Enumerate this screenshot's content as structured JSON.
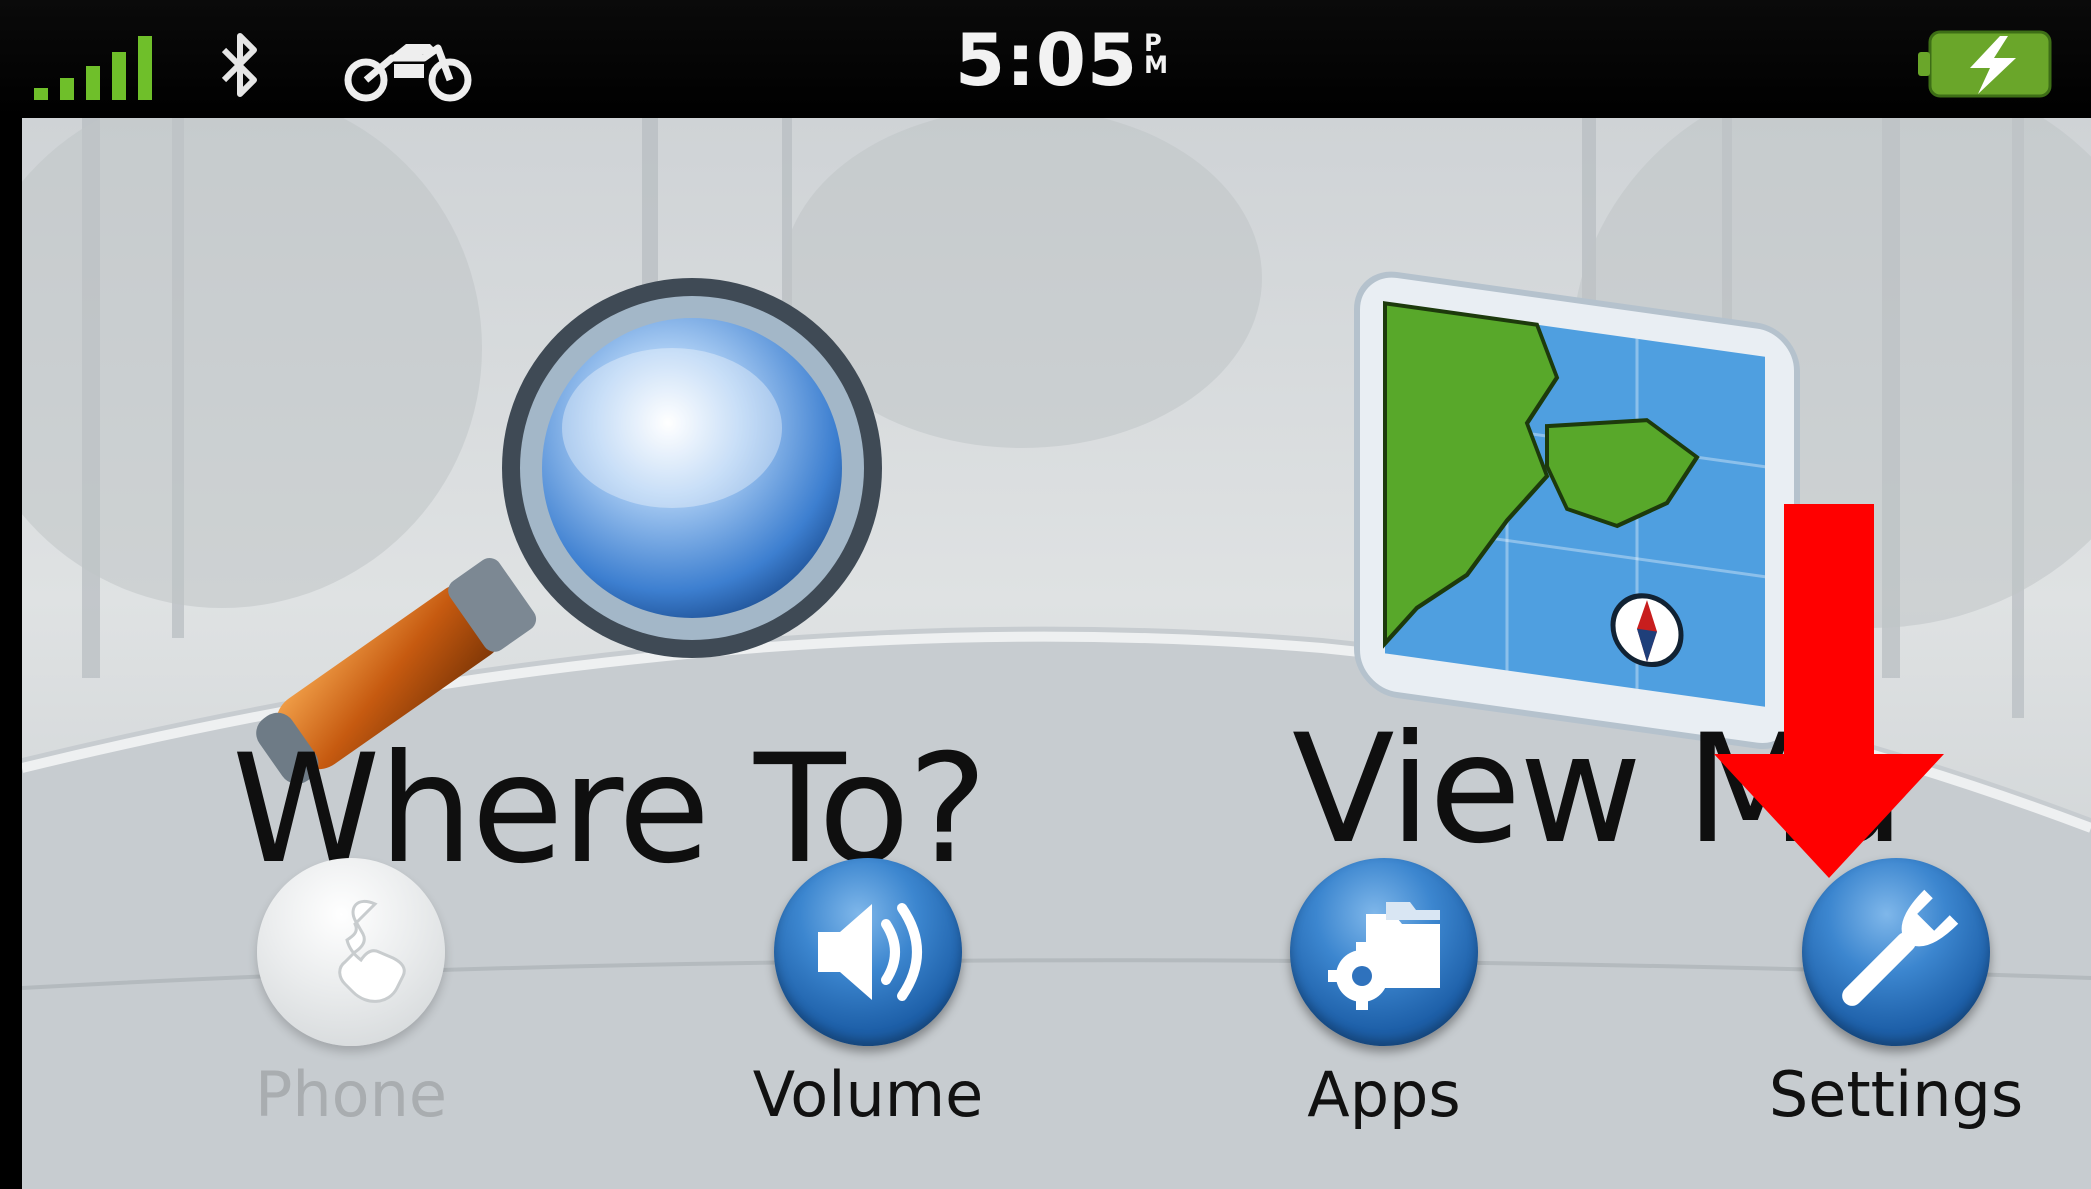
{
  "status_bar": {
    "time": "5:05",
    "ampm_top": "P",
    "ampm_bottom": "M",
    "icons": [
      "signal-bars-icon",
      "bluetooth-icon",
      "motorcycle-icon",
      "battery-charging-icon"
    ]
  },
  "main_tiles": {
    "where_to": {
      "label": "Where To?",
      "icon": "magnifying-glass-icon"
    },
    "view_map": {
      "label": "View Ma",
      "icon": "map-icon"
    }
  },
  "bottom_buttons": [
    {
      "label": "Phone",
      "icon": "phone-icon",
      "enabled": false
    },
    {
      "label": "Volume",
      "icon": "speaker-icon",
      "enabled": true
    },
    {
      "label": "Apps",
      "icon": "apps-gear-folder-icon",
      "enabled": true
    },
    {
      "label": "Settings",
      "icon": "wrench-icon",
      "enabled": true
    }
  ],
  "annotation": {
    "icon": "red-down-arrow-icon",
    "color": "#ff0000"
  },
  "colors": {
    "signal_green": "#6fbf2a",
    "button_blue": "#1f63b0",
    "battery_green": "#6aa62a"
  }
}
